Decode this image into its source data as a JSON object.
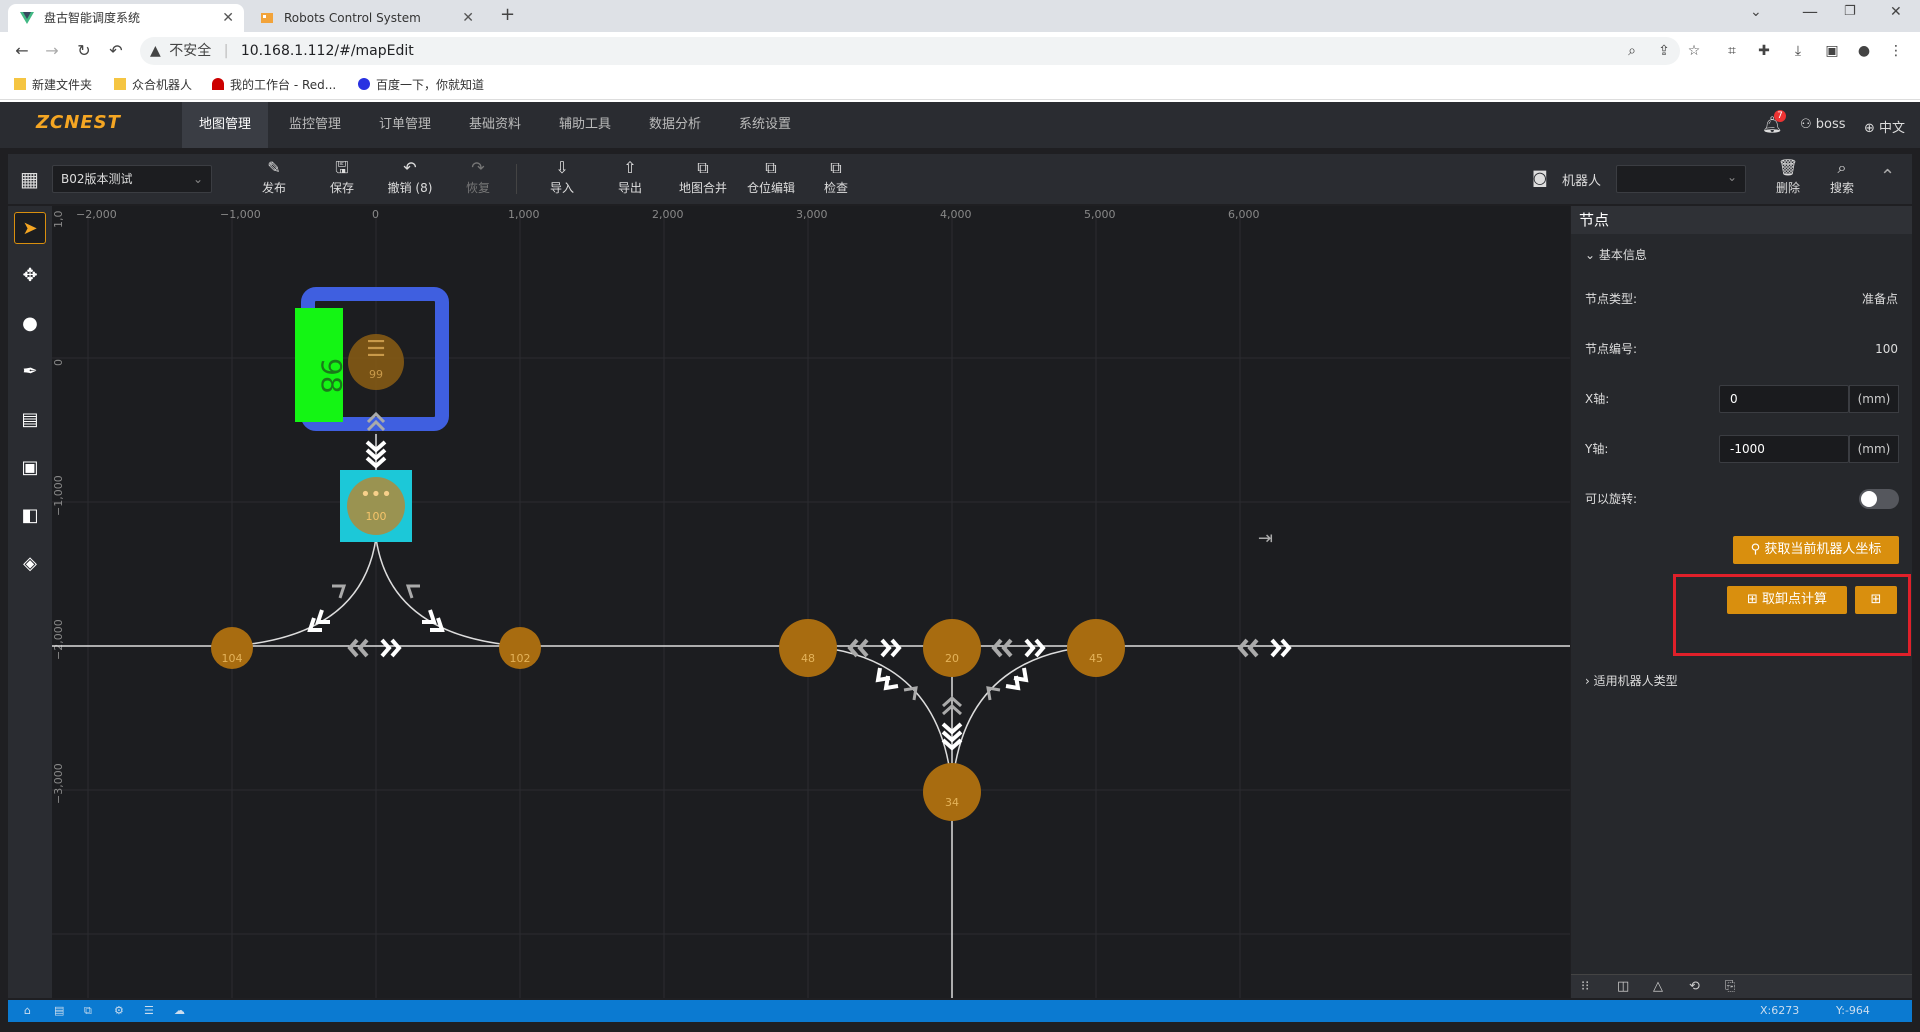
{
  "browser": {
    "tabs": [
      {
        "title": "盘古智能调度系统"
      },
      {
        "title": "Robots Control System"
      }
    ],
    "security_label": "不安全",
    "url": "10.168.1.112/#/mapEdit",
    "bookmarks": [
      "新建文件夹",
      "众合机器人",
      "我的工作台 - Red...",
      "百度一下，你就知道"
    ]
  },
  "app": {
    "logo": "ZCNEST",
    "nav": [
      "地图管理",
      "监控管理",
      "订单管理",
      "基础资料",
      "辅助工具",
      "数据分析",
      "系统设置"
    ],
    "notifications": "7",
    "user": "boss",
    "language": "中文"
  },
  "toolbar": {
    "map_select": "B02版本测试",
    "buttons": [
      "发布",
      "保存",
      "撤销 (8)",
      "恢复",
      "导入",
      "导出",
      "地图合并",
      "仓位编辑",
      "检查"
    ],
    "robot_label": "机器人",
    "robot_select": "",
    "delete": "删除",
    "search": "搜索"
  },
  "ruler": {
    "x_ticks": [
      "−2,000",
      "−1,000",
      "0",
      "1,000",
      "2,000",
      "3,000",
      "4,000",
      "5,000",
      "6,000"
    ],
    "y_ticks": [
      "1,0",
      "0",
      "−1,000",
      "−2,000",
      "−3,000"
    ]
  },
  "map": {
    "nodes": [
      "99",
      "100",
      "104",
      "102",
      "48",
      "20",
      "45",
      "34"
    ],
    "station_label": "98"
  },
  "panel": {
    "title": "节点",
    "section_basic": "基本信息",
    "node_type_label": "节点类型:",
    "node_type_value": "准备点",
    "node_id_label": "节点编号:",
    "node_id_value": "100",
    "x_label": "X轴:",
    "x_value": "0",
    "y_label": "Y轴:",
    "y_value": "-1000",
    "unit": "(mm)",
    "rotate_label": "可以旋转:",
    "get_coord_button": "获取当前机器人坐标",
    "calc_button": "取卸点计算",
    "section_robot_types": "适用机器人类型"
  },
  "status": {
    "x": "X:6273",
    "y": "Y:-964"
  }
}
